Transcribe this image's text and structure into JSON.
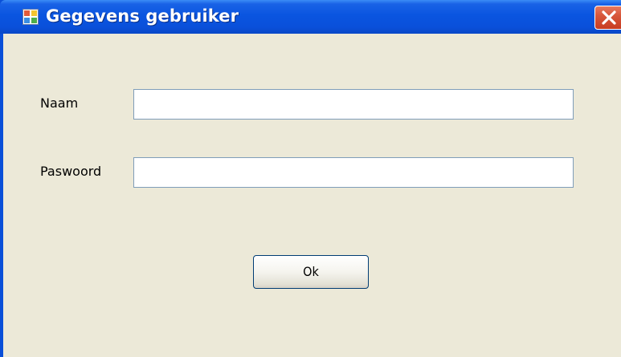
{
  "window": {
    "title": "Gegevens gebruiker",
    "icon": "app-window-icon",
    "titlebar_color": "#0a55e0",
    "client_color": "#ece9d8",
    "close_button_color": "#d7573b"
  },
  "form": {
    "naam_label": "Naam",
    "naam_value": "",
    "paswoord_label": "Paswoord",
    "paswoord_value": "",
    "ok_label": "Ok"
  }
}
